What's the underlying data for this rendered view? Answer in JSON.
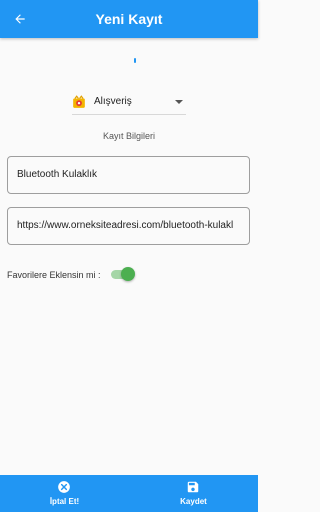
{
  "appbar": {
    "title": "Yeni Kayıt",
    "back_icon": "arrow-back-icon",
    "color": "#2196f3"
  },
  "form": {
    "category": {
      "selected": "Alışveriş",
      "icon": "shopping-cart-icon"
    },
    "section_label": "Kayıt Bilgileri",
    "name_field": {
      "value": "Bluetooth Kulaklık"
    },
    "url_field": {
      "value": "https://www.orneksiteadresi.com/bluetooth-kulakl"
    },
    "favorite": {
      "label": "Favorilere Eklensin mi :",
      "enabled": true,
      "color": "#4caf50"
    }
  },
  "bottom_bar": {
    "cancel": {
      "label": "İptal Et!",
      "icon": "cancel-circle-icon"
    },
    "save": {
      "label": "Kaydet",
      "icon": "save-icon"
    }
  }
}
